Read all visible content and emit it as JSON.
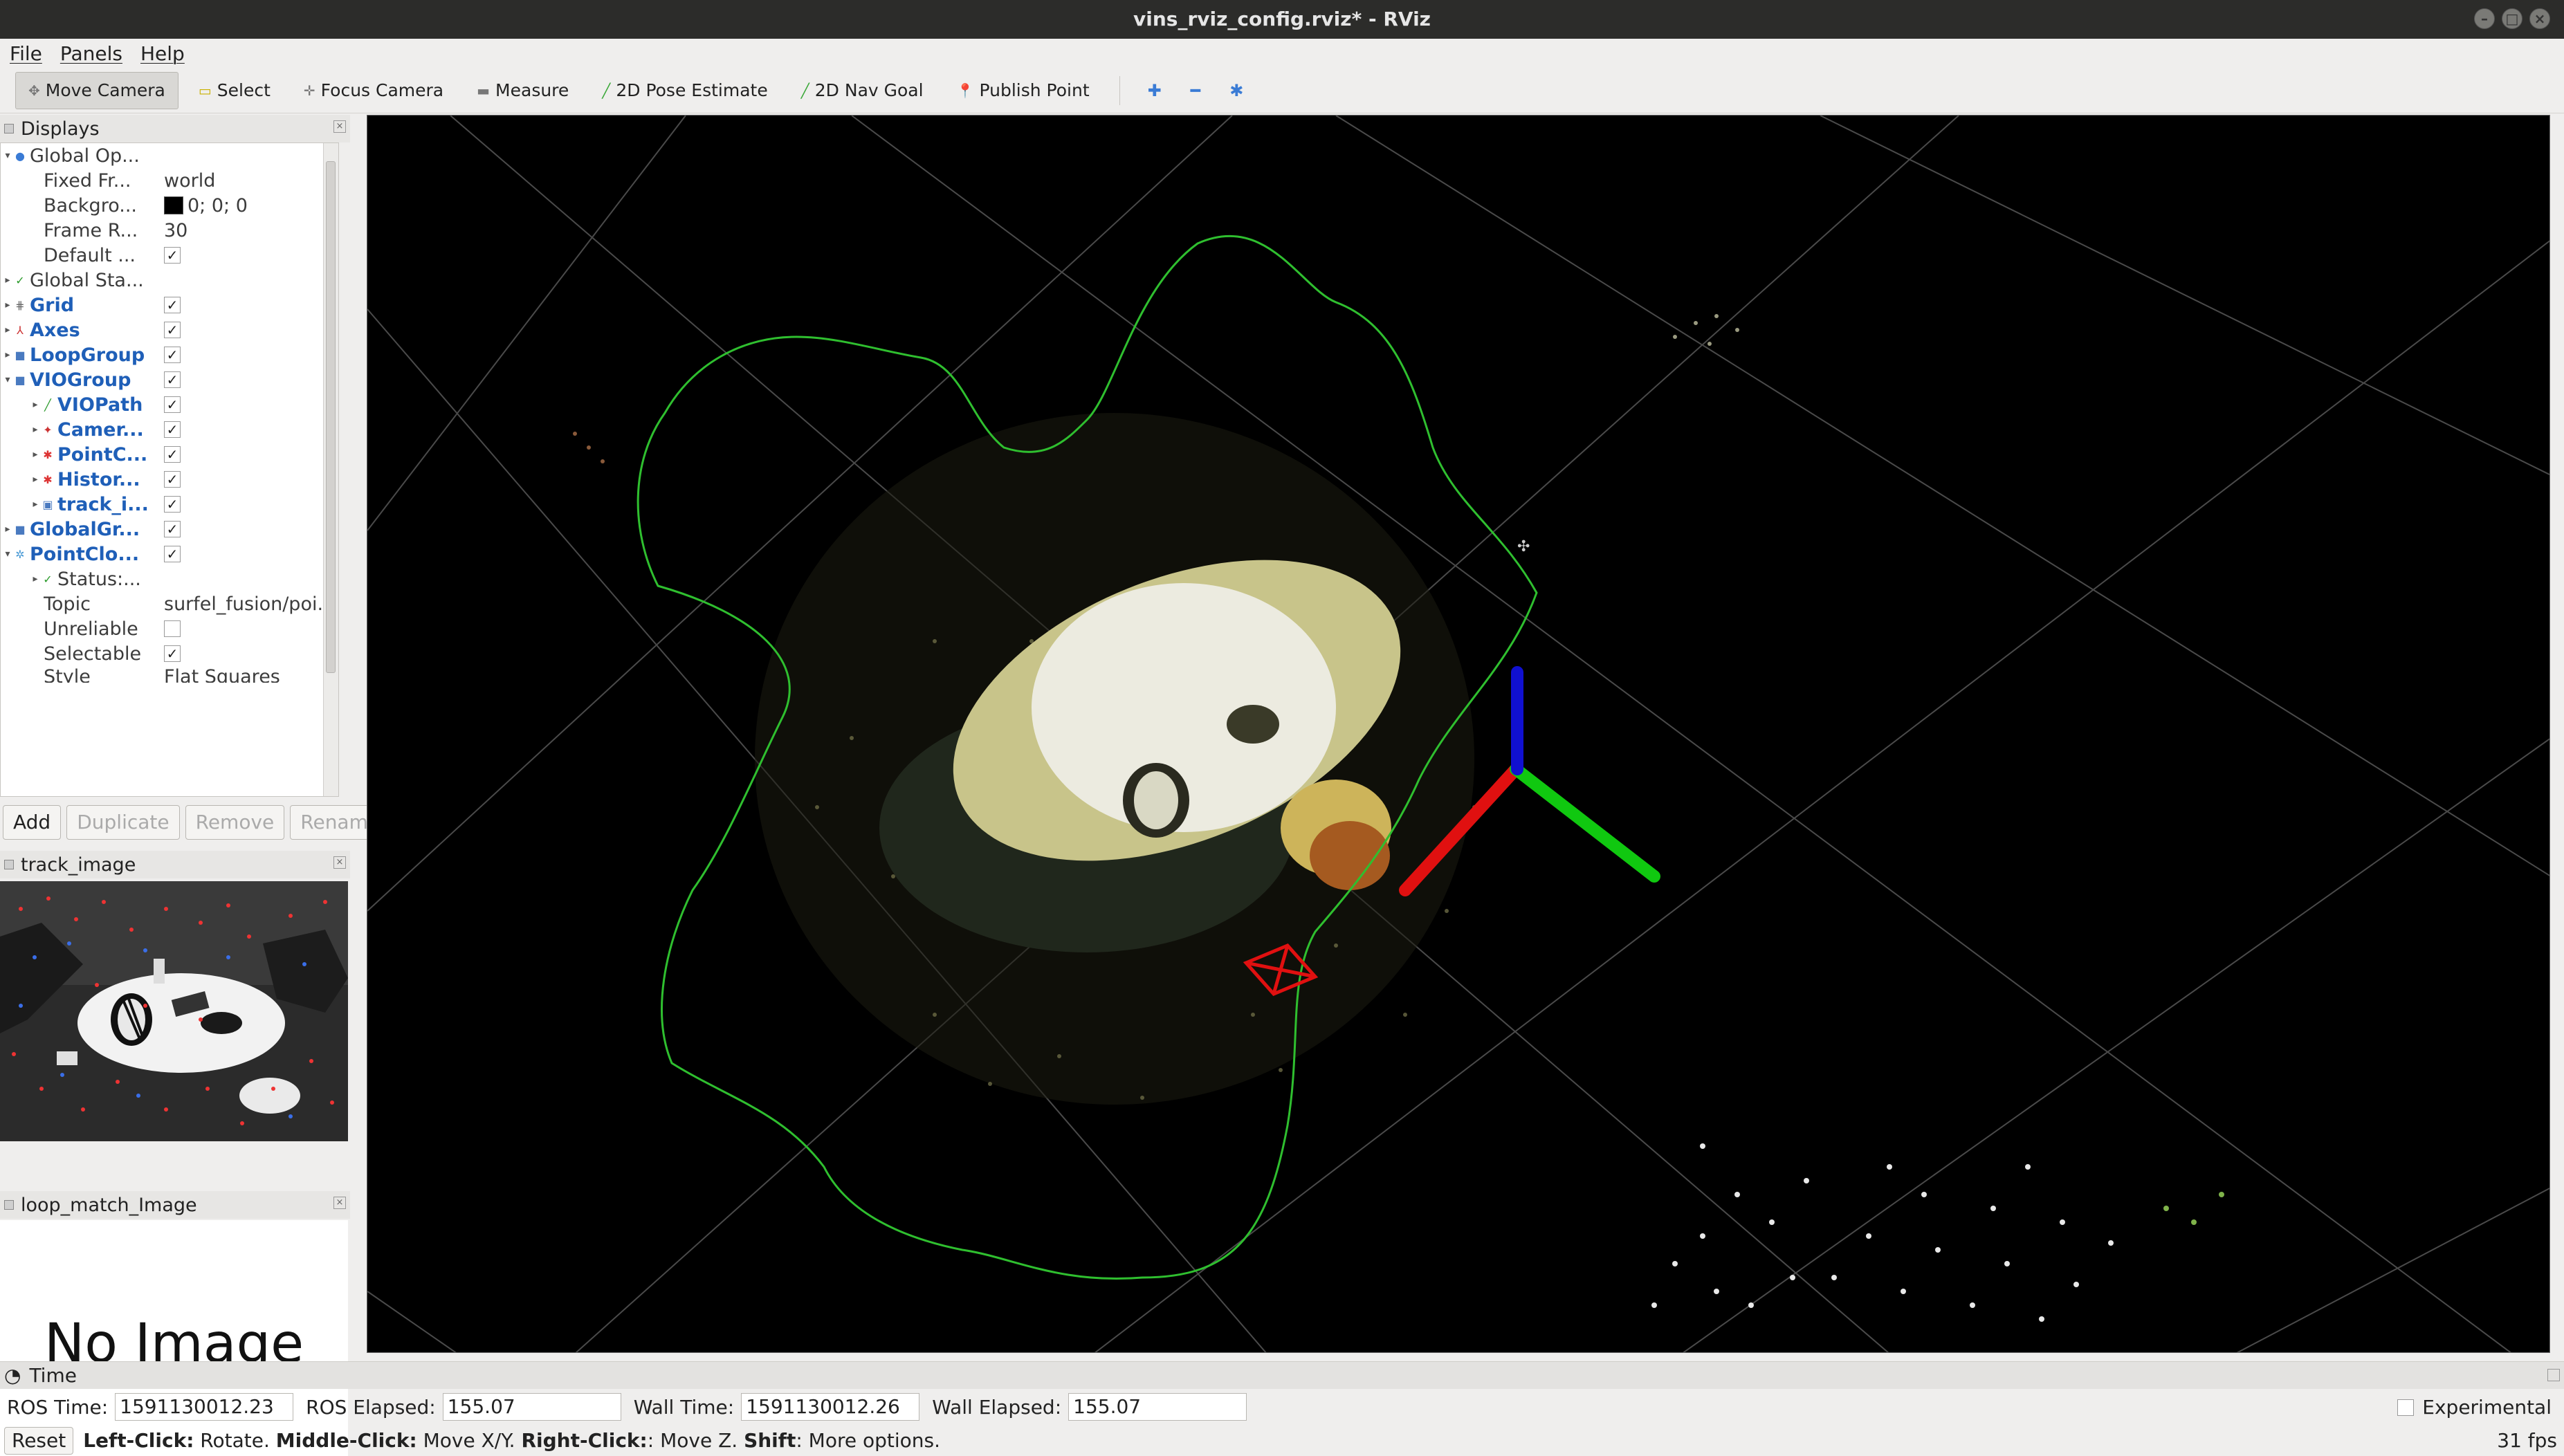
{
  "window": {
    "title": "vins_rviz_config.rviz* - RViz"
  },
  "menu": [
    "File",
    "Panels",
    "Help"
  ],
  "toolbar": {
    "tools": [
      {
        "label": "Move Camera",
        "icon": "move-camera-icon"
      },
      {
        "label": "Select",
        "icon": "select-icon"
      },
      {
        "label": "Focus Camera",
        "icon": "focus-camera-icon"
      },
      {
        "label": "Measure",
        "icon": "measure-icon"
      },
      {
        "label": "2D Pose Estimate",
        "icon": "pose-estimate-icon"
      },
      {
        "label": "2D Nav Goal",
        "icon": "nav-goal-icon"
      },
      {
        "label": "Publish Point",
        "icon": "publish-point-icon"
      }
    ]
  },
  "displays": {
    "title": "Displays",
    "rows": {
      "global_options": "Global Op...",
      "fixed_frame": {
        "label": "Fixed Fr...",
        "value": "world"
      },
      "background": {
        "label": "Backgro...",
        "value": "0; 0; 0"
      },
      "frame_rate": {
        "label": "Frame R...",
        "value": "30"
      },
      "default_light": {
        "label": "Default ..."
      },
      "global_status": "Global Sta...",
      "grid": "Grid",
      "axes": "Axes",
      "loop_group": "LoopGroup",
      "vio_group": "VIOGroup",
      "vio_path": "VIOPath",
      "camera": "Camer...",
      "point_cloud": "PointC...",
      "history": "Histor...",
      "track_image": "track_i...",
      "global_group": "GlobalGr...",
      "point_cloud2": "PointClo...",
      "status": "Status:...",
      "topic": {
        "label": "Topic",
        "value": "surfel_fusion/poi..."
      },
      "unreliable": {
        "label": "Unreliable"
      },
      "selectable": {
        "label": "Selectable"
      },
      "style": {
        "label": "Style",
        "value": "Flat Squares"
      }
    },
    "buttons": {
      "add": "Add",
      "duplicate": "Duplicate",
      "remove": "Remove",
      "rename": "Rename"
    }
  },
  "track_image_panel": {
    "title": "track_image"
  },
  "loop_panel": {
    "title": "loop_match_Image",
    "placeholder": "No Image"
  },
  "time": {
    "title": "Time",
    "ros_time_label": "ROS Time:",
    "ros_time": "1591130012.23",
    "ros_elapsed_label": "ROS Elapsed:",
    "ros_elapsed": "155.07",
    "wall_time_label": "Wall Time:",
    "wall_time": "1591130012.26",
    "wall_elapsed_label": "Wall Elapsed:",
    "wall_elapsed": "155.07",
    "experimental": "Experimental"
  },
  "status": {
    "reset": "Reset",
    "left_click": "Left-Click:",
    "left_action": " Rotate. ",
    "middle_click": "Middle-Click:",
    "middle_action": " Move X/Y. ",
    "right_click": "Right-Click:",
    "right_action": ": Move Z. ",
    "shift": "Shift",
    "shift_action": ": More options.",
    "fps": "31 fps"
  },
  "colors": {
    "background": "#000000",
    "path": "#2fbf2f",
    "axis_x": "#e01010",
    "axis_y": "#10c810",
    "axis_z": "#1010d0",
    "camera_frustum": "#e01010",
    "link_blue": "#1f5fb8"
  }
}
